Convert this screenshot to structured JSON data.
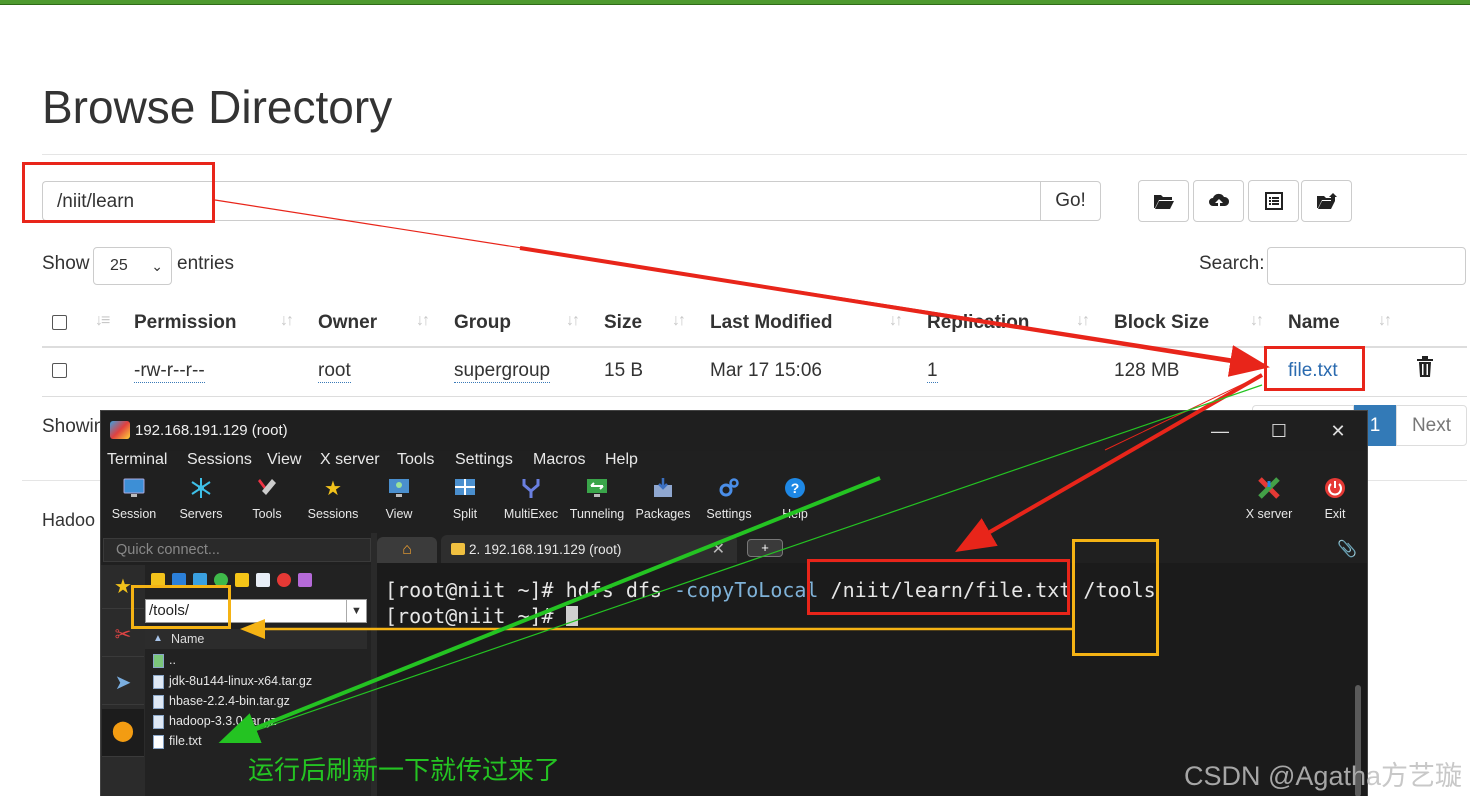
{
  "page": {
    "title": "Browse Directory",
    "path_value": "/niit/learn",
    "go_label": "Go!",
    "toolbar_icons": [
      "folder-open-icon",
      "upload-cloud-icon",
      "list-icon",
      "folder-upload-icon"
    ],
    "show_label": "Show",
    "entries_value": "25",
    "entries_label": "entries",
    "search_label": "Search:",
    "table": {
      "headers": [
        "Permission",
        "Owner",
        "Group",
        "Size",
        "Last Modified",
        "Replication",
        "Block Size",
        "Name"
      ],
      "rows": [
        {
          "permission": "-rw-r--r--",
          "owner": "root",
          "group": "supergroup",
          "size": "15 B",
          "last_modified": "Mar 17 15:06",
          "replication": "1",
          "block_size": "128 MB",
          "name": "file.txt"
        }
      ]
    },
    "showing_text": "Showin",
    "pager": {
      "active": "1",
      "next": "Next"
    },
    "footer_text": "Hadoo"
  },
  "terminal": {
    "window_title": "192.168.191.129 (root)",
    "controls": {
      "minimize": "—",
      "maximize": "☐",
      "close": "✕"
    },
    "menu": [
      "Terminal",
      "Sessions",
      "View",
      "X server",
      "Tools",
      "Settings",
      "Macros",
      "Help"
    ],
    "toolbar": [
      {
        "label": "Session",
        "icon": "monitor-icon"
      },
      {
        "label": "Servers",
        "icon": "servers-icon"
      },
      {
        "label": "Tools",
        "icon": "tools-icon"
      },
      {
        "label": "Sessions",
        "icon": "star-icon"
      },
      {
        "label": "View",
        "icon": "view-icon"
      },
      {
        "label": "Split",
        "icon": "split-icon"
      },
      {
        "label": "MultiExec",
        "icon": "fork-icon"
      },
      {
        "label": "Tunneling",
        "icon": "tunnel-icon"
      },
      {
        "label": "Packages",
        "icon": "package-icon"
      },
      {
        "label": "Settings",
        "icon": "gears-icon"
      },
      {
        "label": "Help",
        "icon": "help-icon"
      }
    ],
    "toolbar_right": [
      {
        "label": "X server",
        "icon": "x-server-icon"
      },
      {
        "label": "Exit",
        "icon": "power-icon"
      }
    ],
    "quick_connect_placeholder": "Quick connect...",
    "sftp": {
      "path": "/tools/",
      "column": "Name",
      "files": [
        "..",
        "jdk-8u144-linux-x64.tar.gz",
        "hbase-2.2.4-bin.tar.gz",
        "hadoop-3.3.0.tar.gz",
        "file.txt"
      ]
    },
    "tab_label": "2. 192.168.191.129 (root)",
    "tab_close": "✕",
    "plus_tab": "+",
    "console": {
      "line1_prompt": "[root@niit ~]# hdfs dfs ",
      "line1_option": "-copyToLocal",
      "line1_src": " /niit/learn/file.txt",
      "line1_dst": " /tools",
      "line2_prompt": "[root@niit ~]# "
    }
  },
  "annotation": {
    "note": "运行后刷新一下就传过来了",
    "watermark": "CSDN @Agatha方艺璇",
    "colors": {
      "red": "#e8251a",
      "orange": "#f5b314",
      "green": "#24c322"
    }
  }
}
